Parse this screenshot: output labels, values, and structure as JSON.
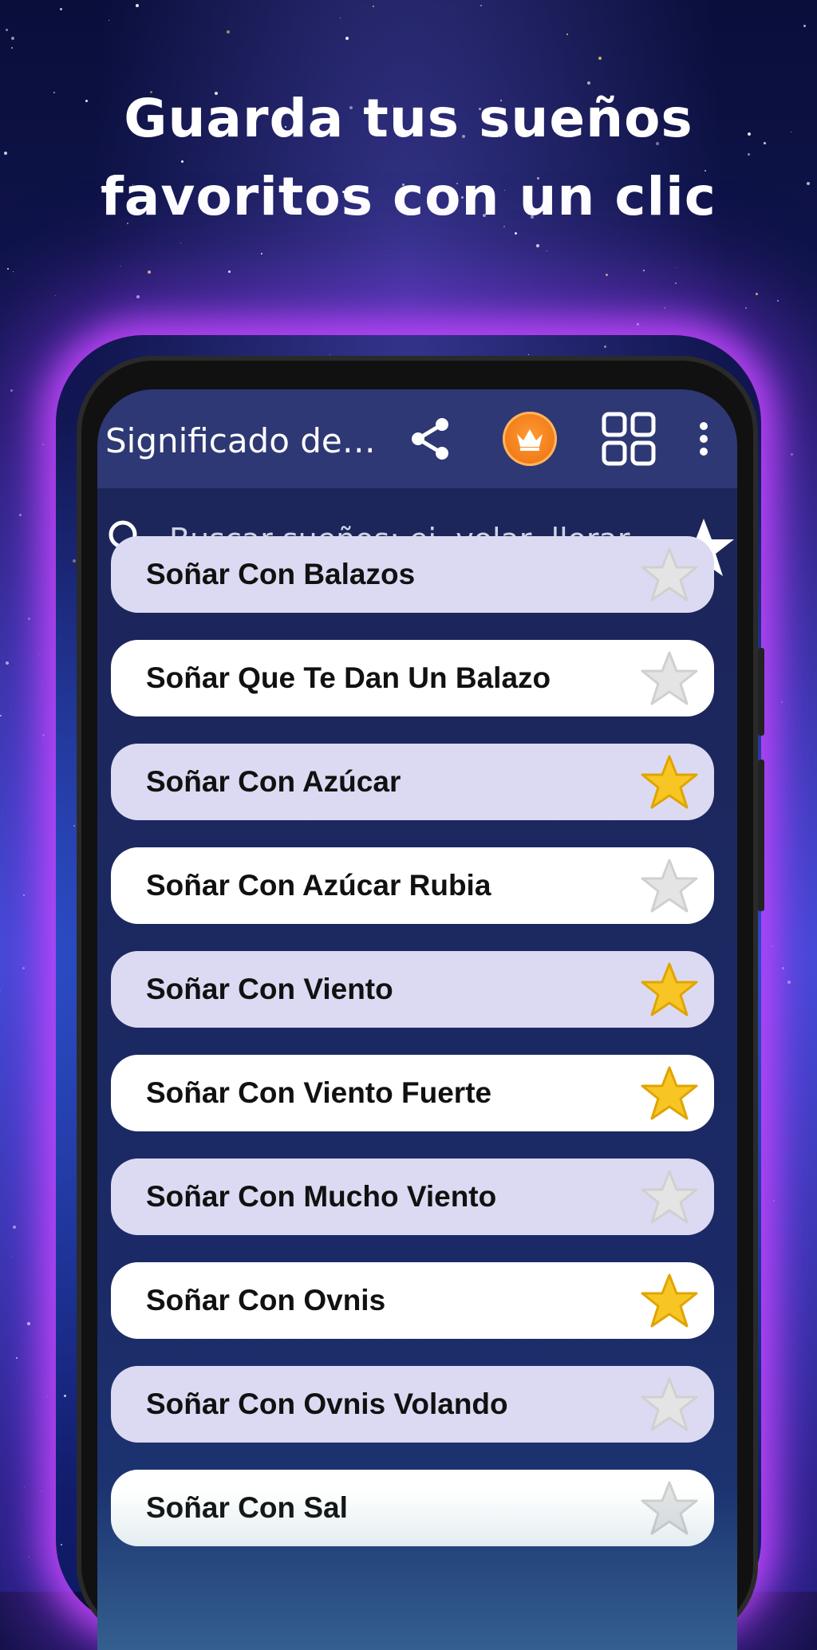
{
  "headline": {
    "line1": "Guarda tus sueños",
    "line2": "favoritos con un clic"
  },
  "appbar": {
    "title": "Significado de l...",
    "icons": [
      "share-icon",
      "crown-icon",
      "grid-icon",
      "more-vert-icon"
    ]
  },
  "search": {
    "placeholder": "Buscar sueños: ej. volar, llorar, ...",
    "value": "",
    "icon": "search-icon",
    "favorites_icon": "star-icon"
  },
  "colors": {
    "appbar": "#2e3874",
    "star_on": "#f7c625",
    "star_off": "#e4e4e4",
    "row_light": "#ffffff",
    "row_lavender": "#dcdaf2",
    "glow": "#c846ff"
  },
  "items": [
    {
      "label": "Soñar Con Balazos",
      "favorite": false,
      "style": "lav"
    },
    {
      "label": "Soñar Que Te Dan Un Balazo",
      "favorite": false,
      "style": "light"
    },
    {
      "label": "Soñar Con Azúcar",
      "favorite": true,
      "style": "lav"
    },
    {
      "label": "Soñar Con Azúcar Rubia",
      "favorite": false,
      "style": "light"
    },
    {
      "label": "Soñar Con Viento",
      "favorite": true,
      "style": "lav"
    },
    {
      "label": "Soñar Con Viento Fuerte",
      "favorite": true,
      "style": "light"
    },
    {
      "label": "Soñar Con Mucho Viento",
      "favorite": false,
      "style": "lav"
    },
    {
      "label": "Soñar Con Ovnis",
      "favorite": true,
      "style": "light"
    },
    {
      "label": "Soñar Con Ovnis Volando",
      "favorite": false,
      "style": "lav"
    },
    {
      "label": "Soñar Con Sal",
      "favorite": false,
      "style": "light"
    }
  ]
}
